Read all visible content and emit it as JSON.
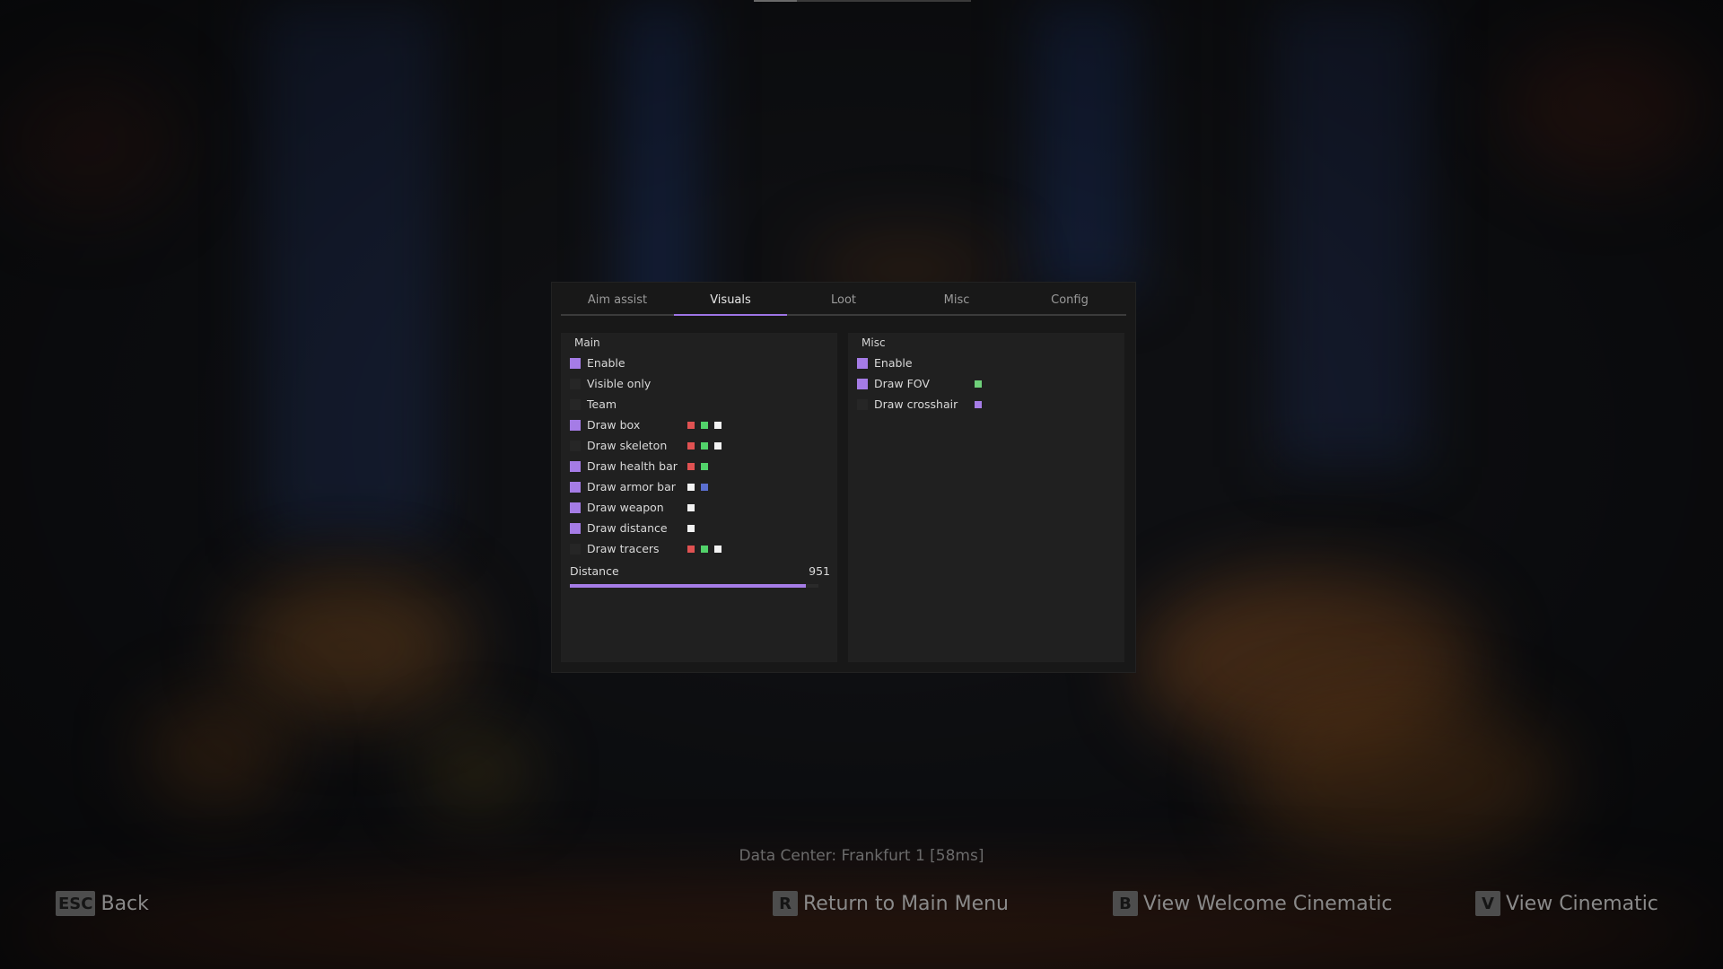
{
  "tabs": [
    {
      "label": "Aim assist"
    },
    {
      "label": "Visuals"
    },
    {
      "label": "Loot"
    },
    {
      "label": "Misc"
    },
    {
      "label": "Config"
    }
  ],
  "active_tab": "Visuals",
  "main_panel": {
    "title": "Main",
    "rows": [
      {
        "label": "Enable",
        "checked": true,
        "colors": []
      },
      {
        "label": "Visible only",
        "checked": false,
        "colors": []
      },
      {
        "label": "Team",
        "checked": false,
        "colors": []
      },
      {
        "label": "Draw box",
        "checked": true,
        "colors": [
          "#e05252",
          "#52d26a",
          "#f2f2f2"
        ]
      },
      {
        "label": "Draw skeleton",
        "checked": false,
        "colors": [
          "#e05252",
          "#52d26a",
          "#f2f2f2"
        ]
      },
      {
        "label": "Draw health bar",
        "checked": true,
        "colors": [
          "#e05252",
          "#52d26a"
        ]
      },
      {
        "label": "Draw armor bar",
        "checked": true,
        "colors": [
          "#f2f2f2",
          "#5a6fd0"
        ]
      },
      {
        "label": "Draw weapon",
        "checked": true,
        "colors": [
          "#f2f2f2"
        ]
      },
      {
        "label": "Draw distance",
        "checked": true,
        "colors": [
          "#f2f2f2"
        ]
      },
      {
        "label": "Draw tracers",
        "checked": false,
        "colors": [
          "#e05252",
          "#52d26a",
          "#f2f2f2"
        ]
      }
    ],
    "slider": {
      "label": "Distance",
      "value": "951",
      "fill_fraction": 0.951
    }
  },
  "misc_panel": {
    "title": "Misc",
    "rows": [
      {
        "label": "Enable",
        "checked": true,
        "colors": []
      },
      {
        "label": "Draw FOV",
        "checked": true,
        "colors": [
          "#6fd07a"
        ]
      },
      {
        "label": "Draw crosshair",
        "checked": false,
        "colors": [
          "#a57ce6"
        ]
      }
    ]
  },
  "footer": {
    "datacenter": "Data Center: Frankfurt 1 [58ms]",
    "actions": [
      {
        "key": "ESC",
        "label": "Back"
      },
      {
        "key": "R",
        "label": "Return to Main Menu"
      },
      {
        "key": "B",
        "label": "View Welcome Cinematic"
      },
      {
        "key": "V",
        "label": "View Cinematic"
      }
    ]
  },
  "colors": {
    "accent": "#a57ce6",
    "panel": "#202020",
    "window": "#181818"
  }
}
